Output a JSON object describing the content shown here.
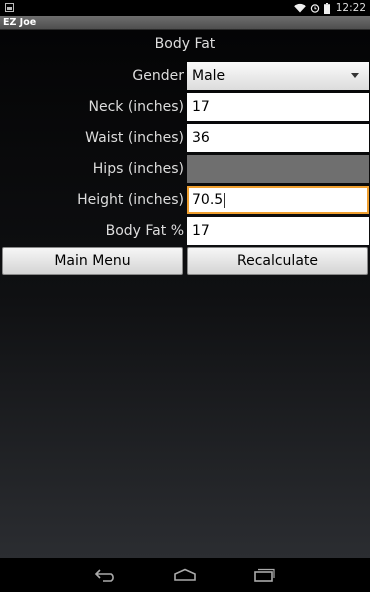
{
  "status_bar": {
    "time": "12:22",
    "icons": [
      "notification-icon",
      "wifi-icon",
      "alarm-icon",
      "battery-icon"
    ]
  },
  "app": {
    "title": "EZ Joe"
  },
  "screen": {
    "title": "Body Fat"
  },
  "form": {
    "gender": {
      "label": "Gender",
      "value": "Male"
    },
    "neck": {
      "label": "Neck (inches)",
      "value": "17"
    },
    "waist": {
      "label": "Waist (inches)",
      "value": "36"
    },
    "hips": {
      "label": "Hips (inches)",
      "value": ""
    },
    "height": {
      "label": "Height (inches)",
      "value": "70.5"
    },
    "body_fat": {
      "label": "Body Fat %",
      "value": "17"
    }
  },
  "buttons": {
    "main_menu": "Main Menu",
    "recalculate": "Recalculate"
  },
  "nav_bar": {
    "icons": [
      "back-icon",
      "home-icon",
      "recent-apps-icon"
    ]
  },
  "colors": {
    "focus_accent": "#f0a030",
    "disabled_field": "#6f6f6f",
    "title_bar": "#5e5e5e"
  }
}
